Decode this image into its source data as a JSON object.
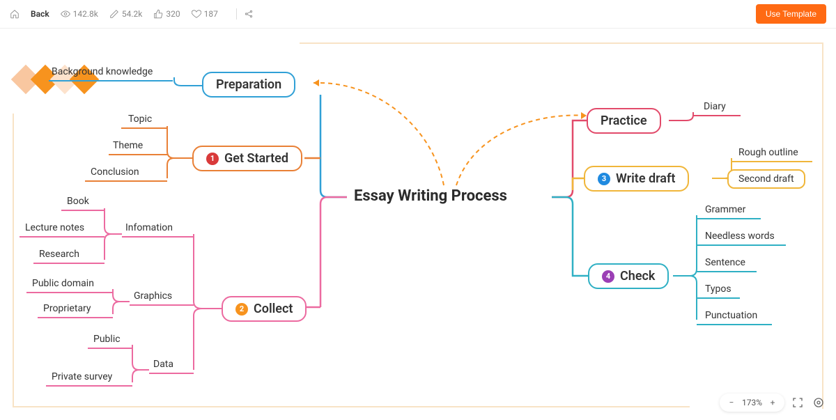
{
  "header": {
    "back": "Back",
    "views": "142.8k",
    "edits": "54.2k",
    "likes": "320",
    "favs": "187",
    "use_template": "Use Template"
  },
  "zoom": {
    "percent": "173%"
  },
  "mindmap": {
    "central": "Essay Writing Process",
    "left": {
      "preparation": {
        "title": "Preparation",
        "children": {
          "bg": "Background knowledge"
        }
      },
      "get_started": {
        "title": "Get Started",
        "badge": "1",
        "children": {
          "topic": "Topic",
          "theme": "Theme",
          "conclusion": "Conclusion"
        }
      },
      "collect": {
        "title": "Collect",
        "badge": "2",
        "children": {
          "information": {
            "title": "Infomation",
            "children": {
              "book": "Book",
              "lecture": "Lecture notes",
              "research": "Research"
            }
          },
          "graphics": {
            "title": "Graphics",
            "children": {
              "public_domain": "Public domain",
              "proprietary": "Proprietary"
            }
          },
          "data": {
            "title": "Data",
            "children": {
              "public": "Public",
              "private_survey": "Private survey"
            }
          }
        }
      }
    },
    "right": {
      "practice": {
        "title": "Practice",
        "children": {
          "diary": "Diary"
        }
      },
      "write_draft": {
        "title": "Write draft",
        "badge": "3",
        "children": {
          "rough": "Rough outline",
          "second": "Second draft"
        }
      },
      "check": {
        "title": "Check",
        "badge": "4",
        "children": {
          "grammar": "Grammer",
          "needless": "Needless words",
          "sentence": "Sentence",
          "typos": "Typos",
          "punctuation": "Punctuation"
        }
      }
    }
  }
}
